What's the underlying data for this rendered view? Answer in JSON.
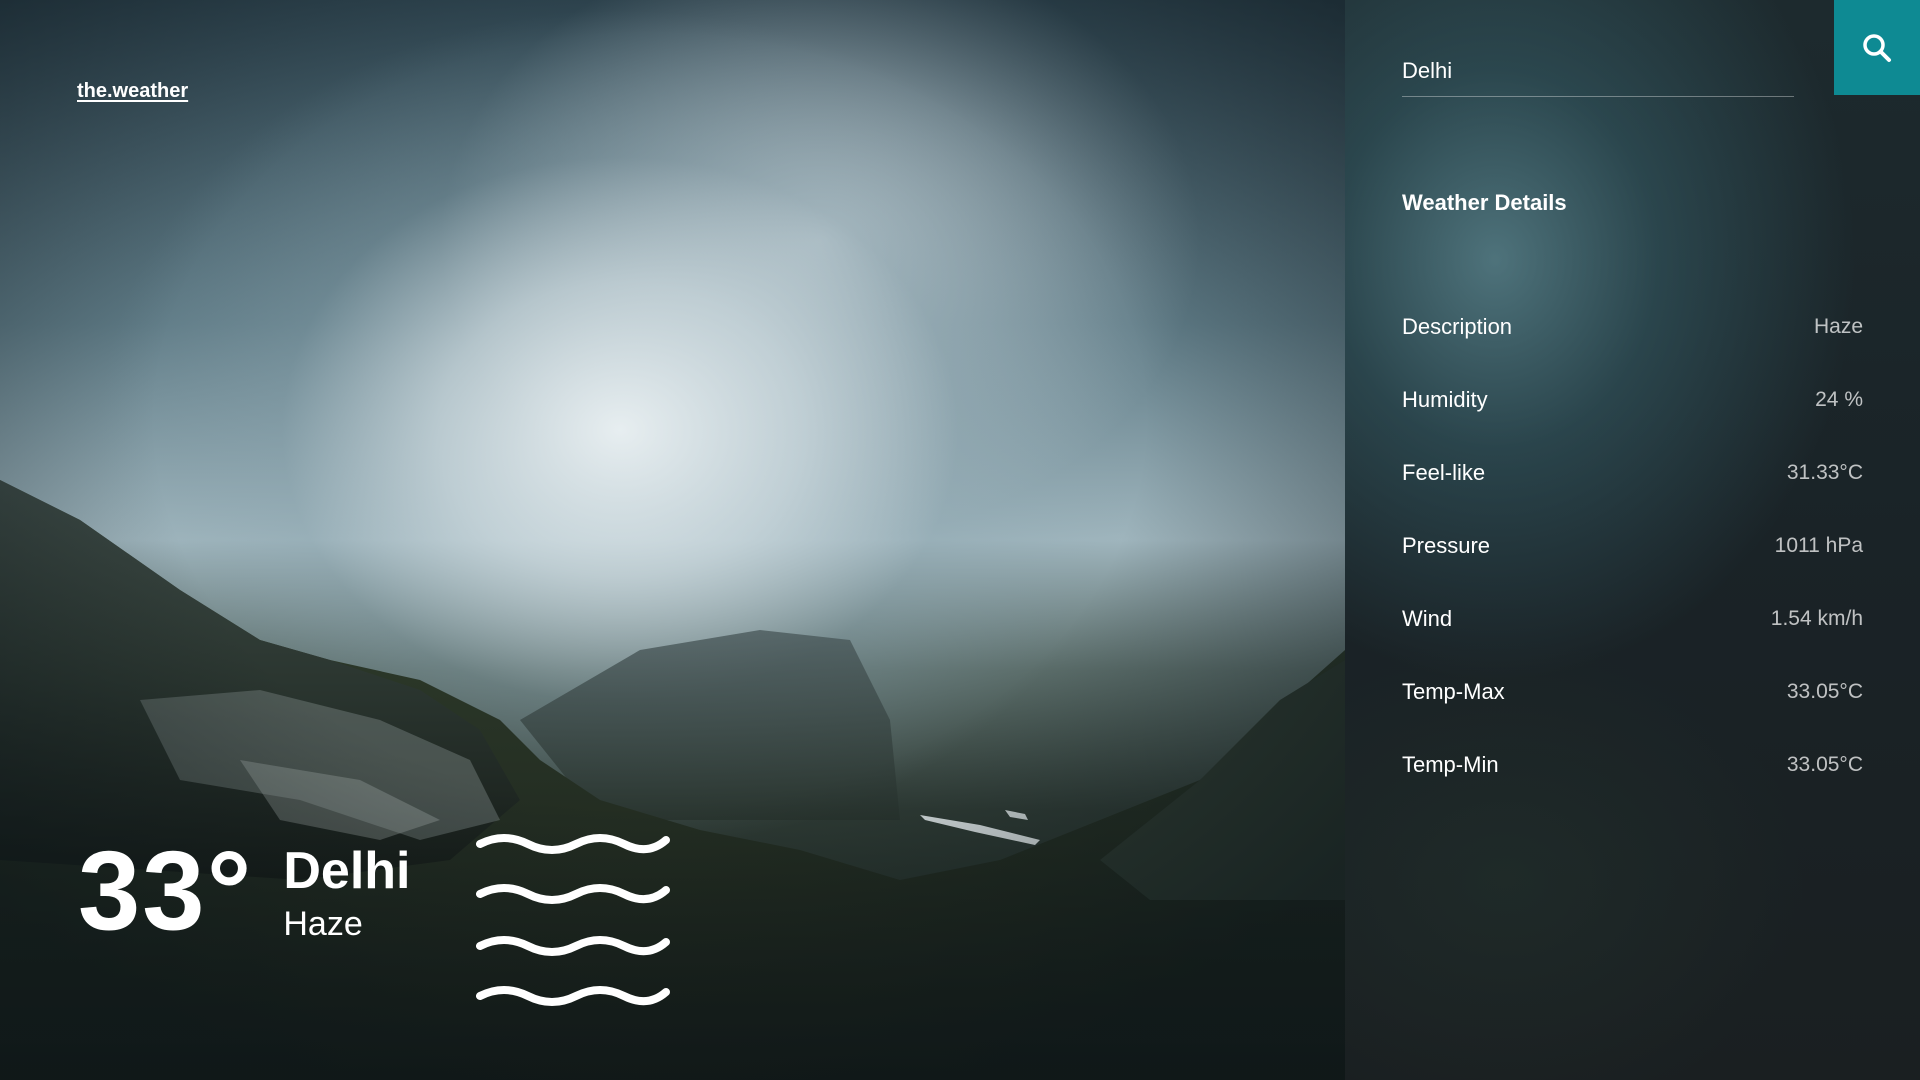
{
  "brand": "the.weather",
  "current": {
    "temperature": "33°",
    "city": "Delhi",
    "condition": "Haze",
    "icon": "haze-icon"
  },
  "search": {
    "value": "Delhi",
    "button_icon": "search-icon",
    "accent": "#0e8a93"
  },
  "details": {
    "title": "Weather Details",
    "rows": [
      {
        "label": "Description",
        "value": "Haze"
      },
      {
        "label": "Humidity",
        "value": "24 %"
      },
      {
        "label": "Feel-like",
        "value": "31.33°C"
      },
      {
        "label": "Pressure",
        "value": "1011 hPa"
      },
      {
        "label": "Wind",
        "value": "1.54 km/h"
      },
      {
        "label": "Temp-Max",
        "value": "33.05°C"
      },
      {
        "label": "Temp-Min",
        "value": "33.05°C"
      }
    ]
  }
}
